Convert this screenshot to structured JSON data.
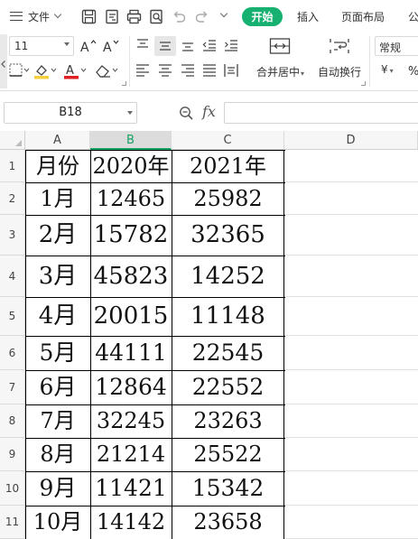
{
  "menu": {
    "file_label": "文件",
    "tabs": [
      "开始",
      "插入",
      "页面布局",
      "公"
    ],
    "active_tab": "开始",
    "accent_color": "#16b071"
  },
  "ribbon": {
    "font_size": "11",
    "merge_label": "合并居中",
    "wrap_label": "自动换行",
    "number_format": "常规",
    "currency_symbol": "¥",
    "font_color": "#e02020",
    "fill_color": "#f4d03f"
  },
  "formula_bar": {
    "name_box": "B18",
    "fx_label": "fx",
    "formula": ""
  },
  "sheet": {
    "columns": [
      "A",
      "B",
      "C",
      "D"
    ],
    "selected_column": "B",
    "rows": [
      {
        "num": "1",
        "a": "月份",
        "b": "2020年",
        "c": "2021年"
      },
      {
        "num": "2",
        "a": "1月",
        "b": "12465",
        "c": "25982"
      },
      {
        "num": "3",
        "a": "2月",
        "b": "15782",
        "c": "32365"
      },
      {
        "num": "4",
        "a": "3月",
        "b": "45823",
        "c": "14252"
      },
      {
        "num": "5",
        "a": "4月",
        "b": "20015",
        "c": "11148"
      },
      {
        "num": "6",
        "a": "5月",
        "b": "44111",
        "c": "22545"
      },
      {
        "num": "7",
        "a": "6月",
        "b": "12864",
        "c": "22552"
      },
      {
        "num": "8",
        "a": "7月",
        "b": "32245",
        "c": "23263"
      },
      {
        "num": "9",
        "a": "8月",
        "b": "21214",
        "c": "25522"
      },
      {
        "num": "10",
        "a": "9月",
        "b": "11421",
        "c": "15342"
      },
      {
        "num": "11",
        "a": "10月",
        "b": "14142",
        "c": "23658"
      }
    ]
  }
}
